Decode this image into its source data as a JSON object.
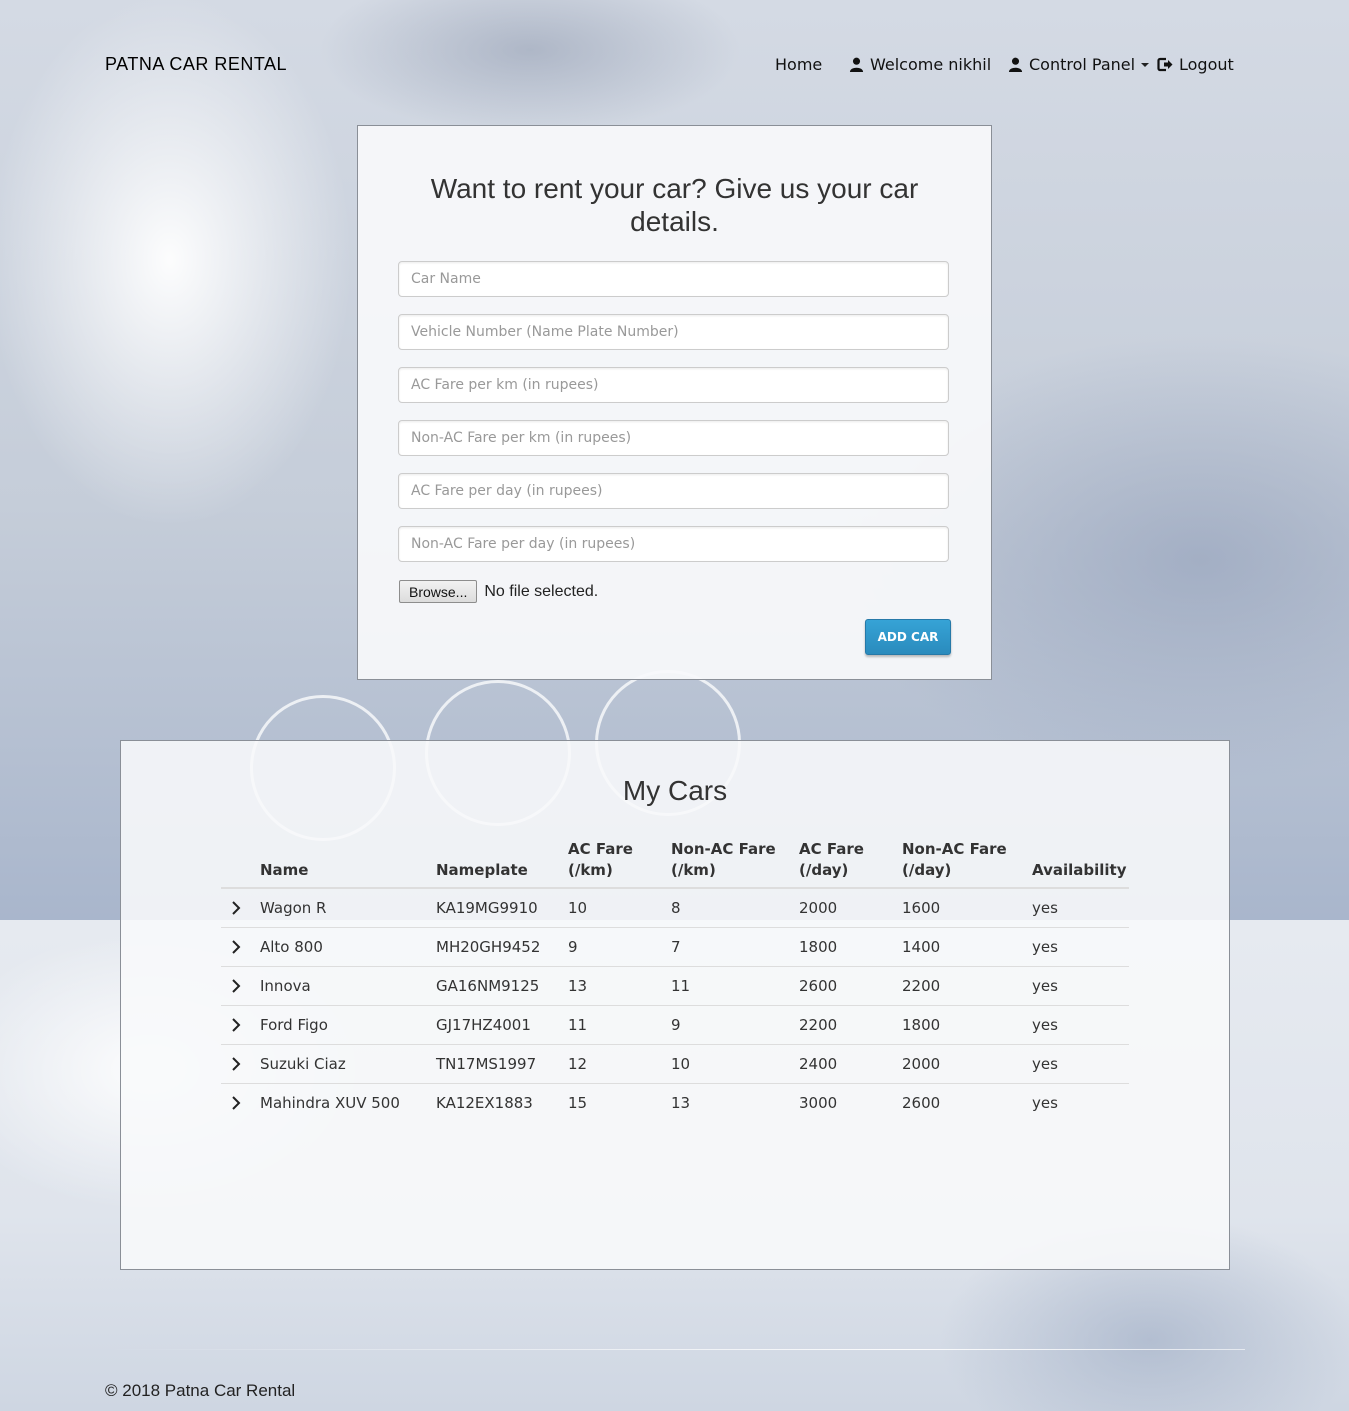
{
  "brand": "PATNA CAR RENTAL",
  "nav": {
    "home": "Home",
    "welcome": "Welcome nikhil",
    "control_panel": "Control Panel",
    "logout": "Logout"
  },
  "form": {
    "title": "Want to rent your car? Give us your car details.",
    "fields": {
      "car_name": "Car Name",
      "vehicle_number": "Vehicle Number (Name Plate Number)",
      "ac_fare_km": "AC Fare per km (in rupees)",
      "nonac_fare_km": "Non-AC Fare per km (in rupees)",
      "ac_fare_day": "AC Fare per day (in rupees)",
      "nonac_fare_day": "Non-AC Fare per day (in rupees)"
    },
    "browse_label": "Browse...",
    "file_status": "No file selected.",
    "submit_label": "ADD CAR"
  },
  "cars": {
    "title": "My Cars",
    "headers": {
      "name": "Name",
      "nameplate": "Nameplate",
      "ac_km_1": "AC Fare",
      "ac_km_2": "(/km)",
      "nonac_km_1": "Non-AC Fare",
      "nonac_km_2": "(/km)",
      "ac_day_1": "AC Fare",
      "ac_day_2": "(/day)",
      "nonac_day_1": "Non-AC Fare",
      "nonac_day_2": "(/day)",
      "availability": "Availability"
    },
    "rows": [
      {
        "name": "Wagon R",
        "nameplate": "KA19MG9910",
        "ac_km": "10",
        "nonac_km": "8",
        "ac_day": "2000",
        "nonac_day": "1600",
        "availability": "yes"
      },
      {
        "name": "Alto 800",
        "nameplate": "MH20GH9452",
        "ac_km": "9",
        "nonac_km": "7",
        "ac_day": "1800",
        "nonac_day": "1400",
        "availability": "yes"
      },
      {
        "name": "Innova",
        "nameplate": "GA16NM9125",
        "ac_km": "13",
        "nonac_km": "11",
        "ac_day": "2600",
        "nonac_day": "2200",
        "availability": "yes"
      },
      {
        "name": "Ford Figo",
        "nameplate": "GJ17HZ4001",
        "ac_km": "11",
        "nonac_km": "9",
        "ac_day": "2200",
        "nonac_day": "1800",
        "availability": "yes"
      },
      {
        "name": "Suzuki Ciaz",
        "nameplate": "TN17MS1997",
        "ac_km": "12",
        "nonac_km": "10",
        "ac_day": "2400",
        "nonac_day": "2000",
        "availability": "yes"
      },
      {
        "name": "Mahindra XUV 500",
        "nameplate": "KA12EX1883",
        "ac_km": "15",
        "nonac_km": "13",
        "ac_day": "3000",
        "nonac_day": "2600",
        "availability": "yes"
      }
    ]
  },
  "footer": "© 2018 Patna Car Rental"
}
